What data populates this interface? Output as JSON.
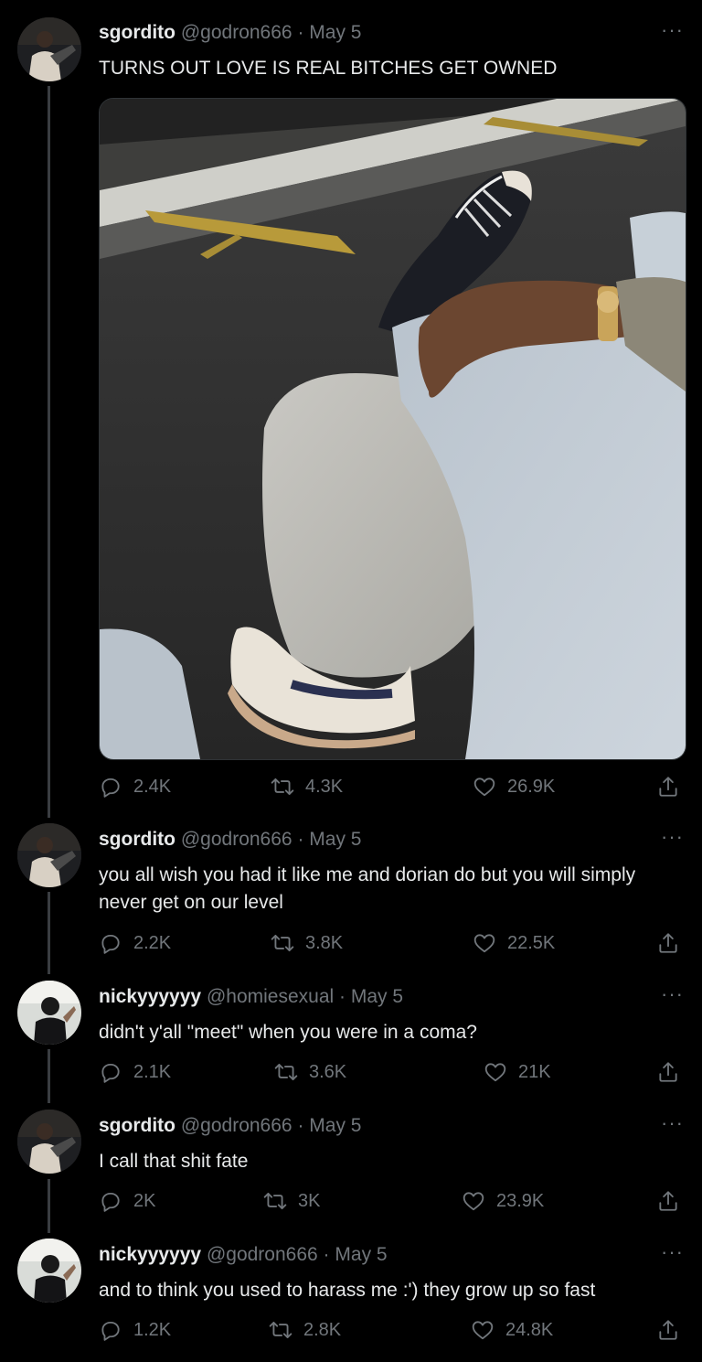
{
  "tweets": [
    {
      "author_name": "sgordito",
      "handle": "@godron666",
      "date": "May 5",
      "text": "TURNS OUT LOVE IS REAL BITCHES GET OWNED",
      "replies": "2.4K",
      "retweets": "4.3K",
      "likes": "26.9K"
    },
    {
      "author_name": "sgordito",
      "handle": "@godron666",
      "date": "May 5",
      "text": "you all wish you had it like me and dorian do but you will simply never get on our level",
      "replies": "2.2K",
      "retweets": "3.8K",
      "likes": "22.5K"
    },
    {
      "author_name": "nickyyyyyy",
      "handle": "@homiesexual",
      "date": "May 5",
      "text": "didn't y'all \"meet\" when you were in a coma?",
      "replies": "2.1K",
      "retweets": "3.6K",
      "likes": "21K"
    },
    {
      "author_name": "sgordito",
      "handle": "@godron666",
      "date": "May 5",
      "text": "I call that shit fate",
      "replies": "2K",
      "retweets": "3K",
      "likes": "23.9K"
    },
    {
      "author_name": "nickyyyyyy",
      "handle": "@godron666",
      "date": "May 5",
      "text": "and to think you used to harass me :') they grow up so fast",
      "replies": "1.2K",
      "retweets": "2.8K",
      "likes": "24.8K"
    }
  ],
  "separator": "·",
  "more_label": "···",
  "icons": {
    "reply": "reply-icon",
    "retweet": "retweet-icon",
    "like": "heart-icon",
    "share": "share-icon",
    "more": "more-icon"
  },
  "colors": {
    "background": "#000000",
    "text_primary": "#e7e9ea",
    "text_secondary": "#71767b",
    "thread_line": "#3a3d41"
  }
}
